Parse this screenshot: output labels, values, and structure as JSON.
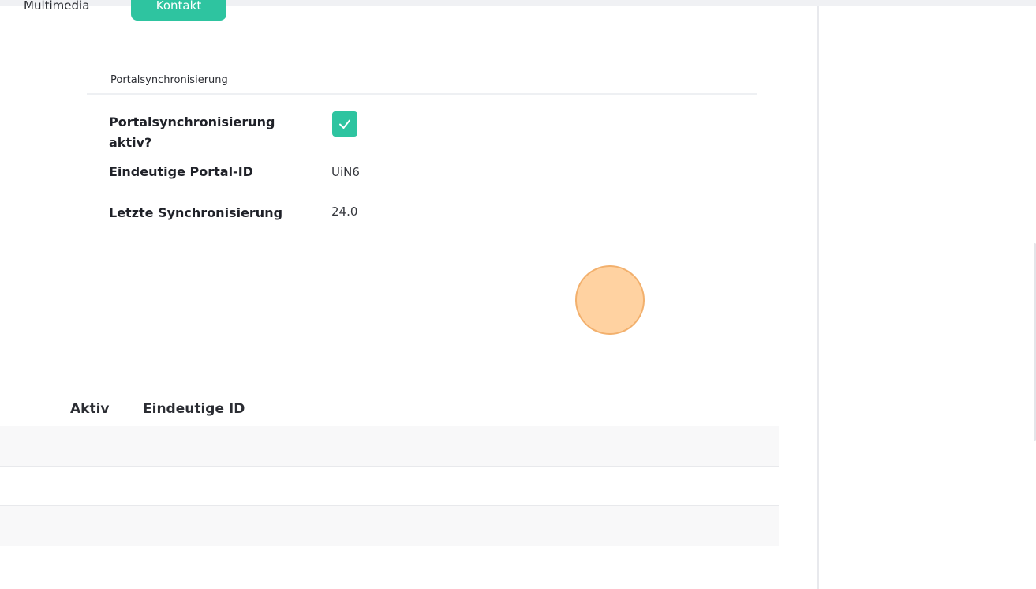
{
  "tabs": {
    "multimedia_label": "Multimedia",
    "active_label": "Kontakt"
  },
  "portal_section": {
    "title": "Portalsynchronisierung",
    "fields": [
      {
        "label": "Portalsynchronisierung aktiv?",
        "type": "checkbox",
        "checked": true
      },
      {
        "label": "Eindeutige Portal-ID",
        "value": "UiN6"
      },
      {
        "label": "Letzte Synchronisierung",
        "value": "24.0"
      }
    ]
  },
  "table": {
    "columns": [
      "Aktiv",
      "Eindeutige ID"
    ],
    "rows": [
      {
        "aktiv": "",
        "id": ""
      },
      {
        "aktiv": "",
        "id": ""
      },
      {
        "aktiv": "",
        "id": ""
      },
      {
        "aktiv": "",
        "id": ""
      }
    ]
  },
  "colors": {
    "accent": "#2ec4a0",
    "cursor_highlight": "#ffc88c"
  },
  "icons": {
    "checkbox_check": "check-icon"
  }
}
